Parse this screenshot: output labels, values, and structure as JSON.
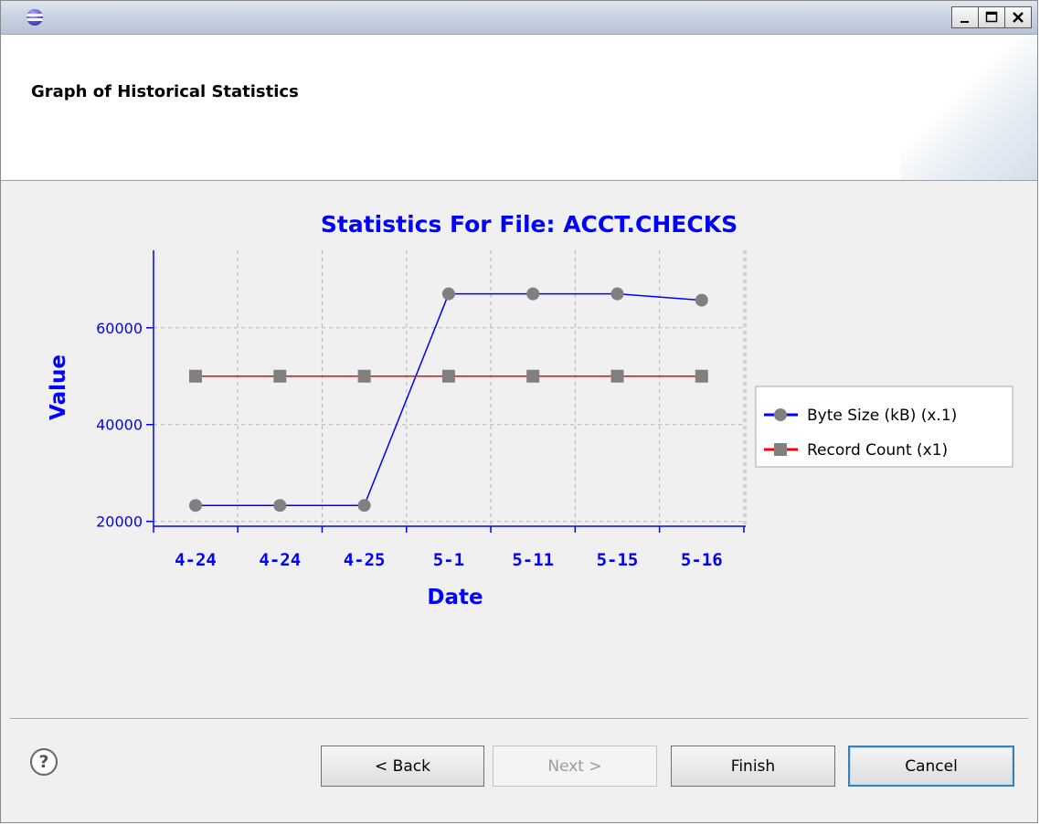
{
  "window": {
    "title": "",
    "icon": "eclipse-app-icon",
    "controls": {
      "minimize": "_",
      "maximize": "□",
      "close": "✕"
    }
  },
  "banner": {
    "title": "Graph of Historical Statistics"
  },
  "chart_data": {
    "type": "line",
    "title": "Statistics For File: ACCT.CHECKS",
    "xlabel": "Date",
    "ylabel": "Value",
    "categories": [
      "4-24",
      "4-24",
      "4-25",
      "5-1",
      "5-11",
      "5-15",
      "5-16"
    ],
    "yticks": [
      20000,
      40000,
      60000
    ],
    "ylim": [
      19000,
      76000
    ],
    "grid": true,
    "legend_position": "right",
    "series": [
      {
        "name": "Byte Size (kB) (x.1)",
        "color": "#0000ff",
        "marker": "circle",
        "values": [
          23300,
          23300,
          23300,
          67000,
          67000,
          67000,
          65700
        ]
      },
      {
        "name": "Record Count (x1)",
        "color": "#ff0000",
        "marker": "square",
        "values": [
          50000,
          50000,
          50000,
          50000,
          50000,
          50000,
          50000
        ]
      }
    ],
    "colors": {
      "axis": "#0000ff",
      "text": "#0000ff",
      "grid": "#b4b4b4",
      "marker": "#808080"
    }
  },
  "buttons": {
    "help": "?",
    "back": "< Back",
    "next": "Next >",
    "finish": "Finish",
    "cancel": "Cancel"
  }
}
